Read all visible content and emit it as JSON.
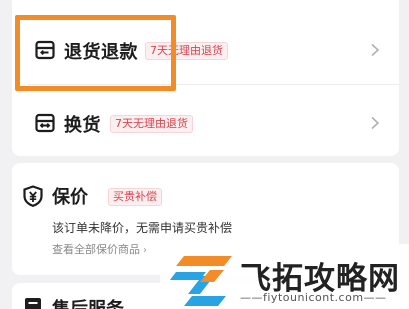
{
  "refund": {
    "title": "退货退款",
    "badge": "7天无理由退货"
  },
  "exchange": {
    "title": "换货",
    "badge": "7天无理由退货"
  },
  "price_protection": {
    "title": "保价",
    "badge": "买贵补偿",
    "description": "该订单未降价，无需申请买贵补偿",
    "link": "查看全部保价商品",
    "link_arrow": "›"
  },
  "after_sales": {
    "title": "售后服务"
  },
  "watermark": {
    "title": "飞拓攻略网",
    "url": "——fiytounicont.com——"
  },
  "colors": {
    "highlight": "#f28c28",
    "badge_text": "#d8434f",
    "badge_bg": "#fdeff0"
  },
  "icons": {
    "refund": "box-return-icon",
    "exchange": "box-exchange-icon",
    "protect": "yuan-shield-icon",
    "service": "service-icon",
    "chevron": "chevron-right-icon"
  }
}
